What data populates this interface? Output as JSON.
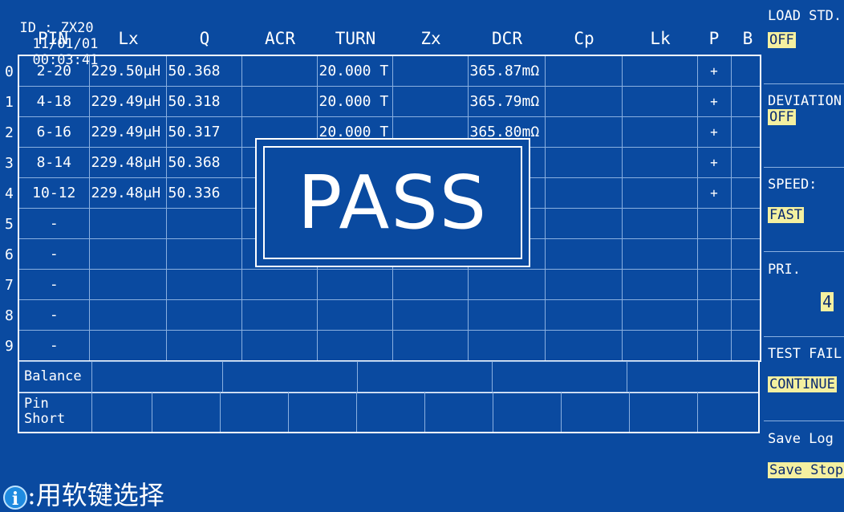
{
  "status": {
    "id": "ID : ZX20",
    "date": "11/01/01",
    "time": "00:03:41"
  },
  "headers": [
    "PIN",
    "Lx",
    "Q",
    "ACR",
    "TURN",
    "Zx",
    "DCR",
    "Cp",
    "Lk",
    "P",
    "B"
  ],
  "rows": [
    {
      "idx": "0",
      "pin": "2-20",
      "lx": "229.50μH",
      "q": "50.368",
      "acr": "",
      "turn": "20.000 T",
      "zx": "",
      "dcr": "365.87mΩ",
      "cp": "",
      "lk": "",
      "p": "+",
      "b": ""
    },
    {
      "idx": "1",
      "pin": "4-18",
      "lx": "229.49μH",
      "q": "50.318",
      "acr": "",
      "turn": "20.000 T",
      "zx": "",
      "dcr": "365.79mΩ",
      "cp": "",
      "lk": "",
      "p": "+",
      "b": ""
    },
    {
      "idx": "2",
      "pin": "6-16",
      "lx": "229.49μH",
      "q": "50.317",
      "acr": "",
      "turn": "20.000 T",
      "zx": "",
      "dcr": "365.80mΩ",
      "cp": "",
      "lk": "",
      "p": "+",
      "b": ""
    },
    {
      "idx": "3",
      "pin": "8-14",
      "lx": "229.48μH",
      "q": "50.368",
      "acr": "",
      "turn": "",
      "zx": "",
      "dcr": "Ω",
      "cp": "",
      "lk": "",
      "p": "+",
      "b": ""
    },
    {
      "idx": "4",
      "pin": "10-12",
      "lx": "229.48μH",
      "q": "50.336",
      "acr": "",
      "turn": "",
      "zx": "",
      "dcr": "Ω",
      "cp": "",
      "lk": "",
      "p": "+",
      "b": ""
    },
    {
      "idx": "5",
      "pin": "-",
      "lx": "",
      "q": "",
      "acr": "",
      "turn": "",
      "zx": "",
      "dcr": "",
      "cp": "",
      "lk": "",
      "p": "",
      "b": ""
    },
    {
      "idx": "6",
      "pin": "-",
      "lx": "",
      "q": "",
      "acr": "",
      "turn": "",
      "zx": "",
      "dcr": "",
      "cp": "",
      "lk": "",
      "p": "",
      "b": ""
    },
    {
      "idx": "7",
      "pin": "-",
      "lx": "",
      "q": "",
      "acr": "",
      "turn": "",
      "zx": "",
      "dcr": "",
      "cp": "",
      "lk": "",
      "p": "",
      "b": ""
    },
    {
      "idx": "8",
      "pin": "-",
      "lx": "",
      "q": "",
      "acr": "",
      "turn": "",
      "zx": "",
      "dcr": "",
      "cp": "",
      "lk": "",
      "p": "",
      "b": ""
    },
    {
      "idx": "9",
      "pin": "-",
      "lx": "",
      "q": "",
      "acr": "",
      "turn": "",
      "zx": "",
      "dcr": "",
      "cp": "",
      "lk": "",
      "p": "",
      "b": ""
    }
  ],
  "balance_label": "Balance",
  "pin_short_label_1": "Pin",
  "pin_short_label_2": "Short",
  "overlay": {
    "text": "PASS"
  },
  "side": {
    "load_std": "LOAD STD.",
    "load_std_val": "OFF",
    "deviation": "DEVIATION",
    "deviation_val": "OFF",
    "speed": "SPEED:",
    "speed_val": "FAST",
    "pri": "PRI.",
    "pri_val": "4",
    "test_fail": "TEST FAIL",
    "test_fail_val": "CONTINUE",
    "save_log": "Save Log",
    "save_stop": "Save Stop"
  },
  "info": {
    "icon": "info-icon",
    "icon_glyph": "i",
    "text": ":用软键选择"
  }
}
